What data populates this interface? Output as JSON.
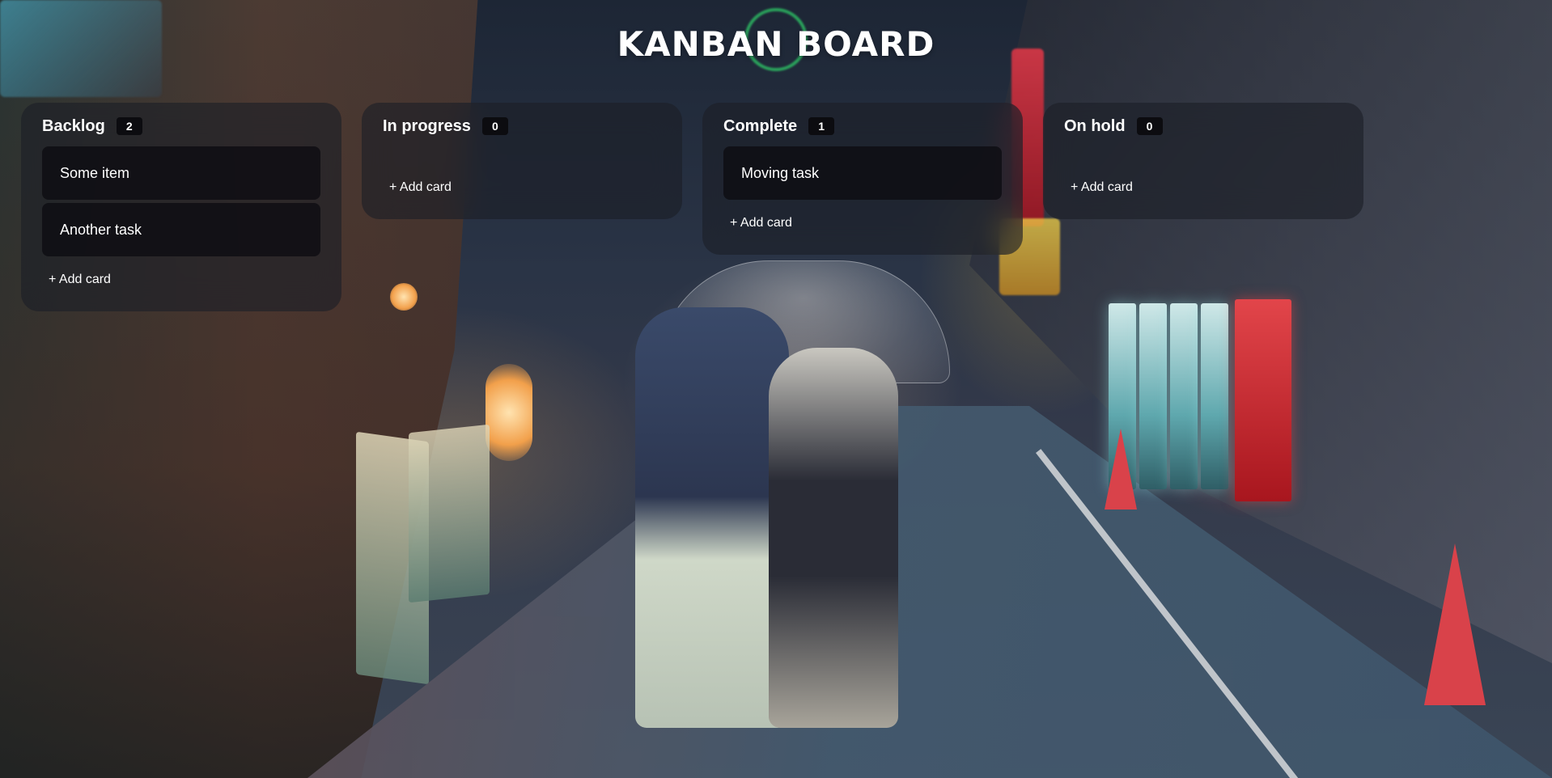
{
  "page": {
    "title": "KANBAN BOARD"
  },
  "columns": [
    {
      "title": "Backlog",
      "count": "2",
      "cards": [
        "Some item",
        "Another task"
      ],
      "add_label": "+ Add card"
    },
    {
      "title": "In progress",
      "count": "0",
      "cards": [],
      "add_label": "+ Add card"
    },
    {
      "title": "Complete",
      "count": "1",
      "cards": [
        "Moving task"
      ],
      "add_label": "+ Add card"
    },
    {
      "title": "On hold",
      "count": "0",
      "cards": [],
      "add_label": "+ Add card"
    }
  ],
  "theme": {
    "panel_bg": "#1c1e26",
    "card_bg": "#0e0e12",
    "badge_bg": "#0c0c10",
    "text": "#ffffff"
  }
}
